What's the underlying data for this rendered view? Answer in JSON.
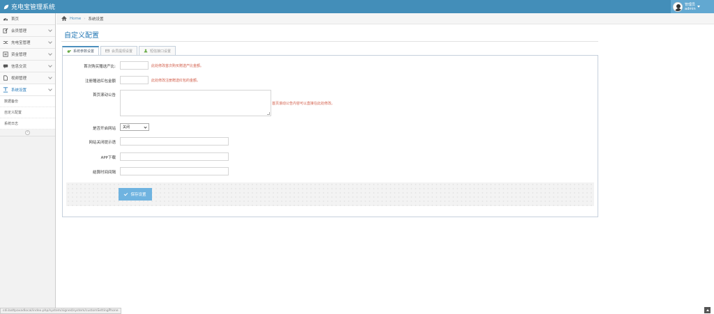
{
  "app": {
    "title": "充电宝管理系统"
  },
  "user": {
    "role": "管理员",
    "name": "admin"
  },
  "sidebar": {
    "items": [
      {
        "label": "首页",
        "icon": "dashboard-icon"
      },
      {
        "label": "会员管理",
        "icon": "edit-icon"
      },
      {
        "label": "充电宝管理",
        "icon": "shuffle-icon"
      },
      {
        "label": "资金管理",
        "icon": "list-icon"
      },
      {
        "label": "信息交流",
        "icon": "chat-icon"
      },
      {
        "label": "视频管理",
        "icon": "file-icon"
      },
      {
        "label": "系统设置",
        "icon": "text-width-icon"
      }
    ],
    "subitems": [
      {
        "label": "数据备份"
      },
      {
        "label": "自定义配置"
      },
      {
        "label": "系统日志"
      }
    ]
  },
  "breadcrumb": {
    "home": "Home",
    "current": "系统设置"
  },
  "page": {
    "title": "自定义配置"
  },
  "tabs": [
    {
      "label": "系统参数设置"
    },
    {
      "label": "会员提现设置"
    },
    {
      "label": "短信接口设置"
    }
  ],
  "form": {
    "first_recharge": {
      "label": "首次购买赠送产比:",
      "value": "",
      "hint": "此处修改首次购买赠送产比金额。"
    },
    "register_bonus": {
      "label": "注册赠送红包金额",
      "value": "",
      "hint": "此处修改注册赠送红包的金额。"
    },
    "home_notice": {
      "label": "首页滚动公告",
      "value": "",
      "hint": "首页滚动公告内容可以直接在此处修改。"
    },
    "site_open": {
      "label": "是否开启网站",
      "value": "关闭"
    },
    "close_tip": {
      "label": "网站关闭提示语",
      "value": ""
    },
    "app_download": {
      "label": "APP下载",
      "value": ""
    },
    "refresh_interval": {
      "label": "结算时间间隔",
      "value": ""
    },
    "save_label": "保存设置"
  },
  "statusbar": {
    "url": "cdi.battpavadlocal/index.php/system/signed/system/customSettingPhone"
  }
}
